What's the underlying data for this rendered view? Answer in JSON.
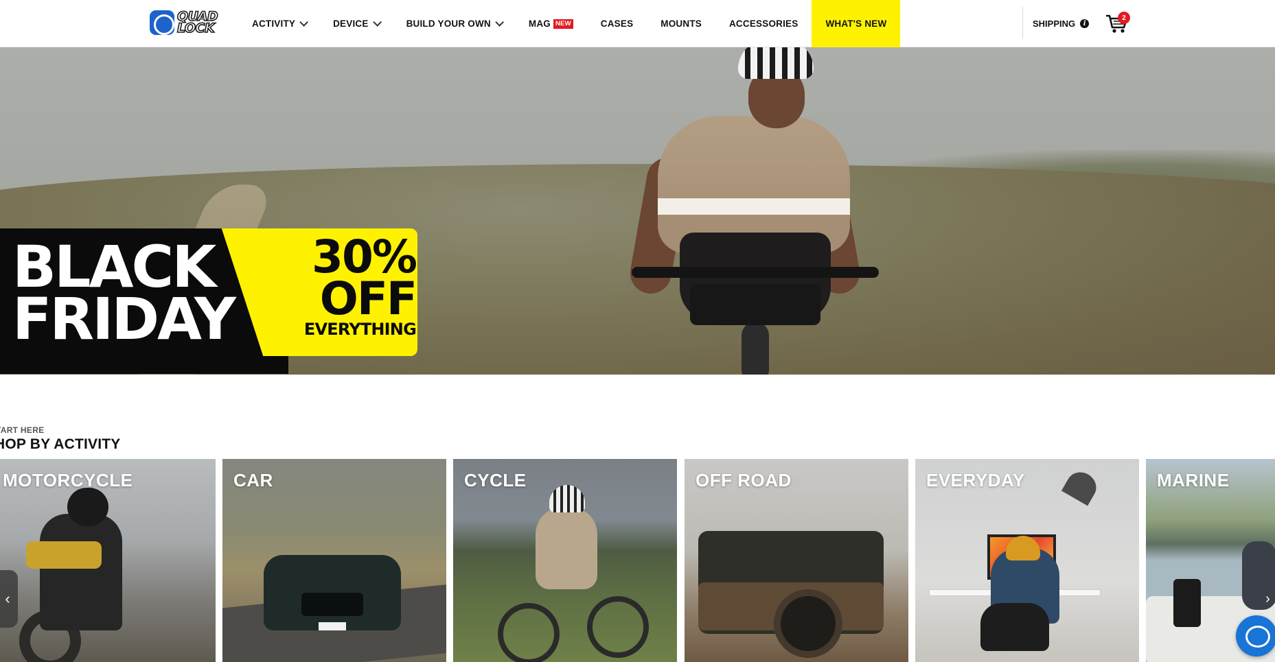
{
  "brand": {
    "logo_line1": "QUAD",
    "logo_line2": "LOCK",
    "accent": "#1d63c9"
  },
  "nav": {
    "items": [
      {
        "label": "ACTIVITY",
        "dropdown": true
      },
      {
        "label": "DEVICE",
        "dropdown": true
      },
      {
        "label": "BUILD YOUR OWN",
        "dropdown": true
      },
      {
        "label": "MAG",
        "badge": "NEW"
      },
      {
        "label": "CASES"
      },
      {
        "label": "MOUNTS"
      },
      {
        "label": "ACCESSORIES"
      },
      {
        "label": "WHAT'S NEW",
        "highlight_color": "#fff200"
      }
    ],
    "shipping_label": "SHIPPING",
    "info_icon": "i",
    "cart_count": "2",
    "badge_color": "#e21b23"
  },
  "hero": {
    "promo_line1": "BLACK",
    "promo_line2": "FRIDAY",
    "discount": "30%",
    "off": "OFF",
    "scope": "EVERYTHING",
    "promo_yellow": "#fff200"
  },
  "section": {
    "eyebrow": "TART HERE",
    "title": "HOP BY ACTIVITY"
  },
  "tiles": [
    {
      "label": "MOTORCYCLE"
    },
    {
      "label": "CAR"
    },
    {
      "label": "CYCLE"
    },
    {
      "label": "OFF ROAD"
    },
    {
      "label": "EVERYDAY"
    },
    {
      "label": "MARINE"
    }
  ],
  "carousel": {
    "prev_icon": "‹",
    "next_icon": "›"
  }
}
